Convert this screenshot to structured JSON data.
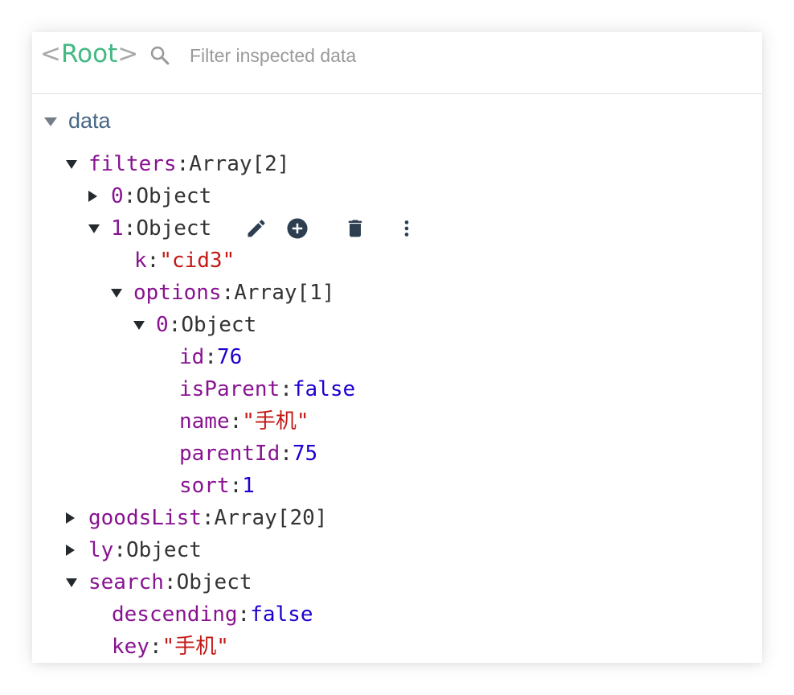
{
  "header": {
    "root_open": "<",
    "root_label": "Root",
    "root_close": ">",
    "filter_placeholder": "Filter inspected data"
  },
  "section": {
    "title": "data"
  },
  "tree": {
    "filters": {
      "key": "filters",
      "type": "Array[2]"
    },
    "filters_0": {
      "key": "0",
      "type": "Object"
    },
    "filters_1": {
      "key": "1",
      "type": "Object"
    },
    "k": {
      "key": "k",
      "value": "\"cid3\""
    },
    "options": {
      "key": "options",
      "type": "Array[1]"
    },
    "options_0": {
      "key": "0",
      "type": "Object"
    },
    "id": {
      "key": "id",
      "value": "76"
    },
    "isParent": {
      "key": "isParent",
      "value": "false"
    },
    "name": {
      "key": "name",
      "value": "\"手机\""
    },
    "parentId": {
      "key": "parentId",
      "value": "75"
    },
    "sort": {
      "key": "sort",
      "value": "1"
    },
    "goodsList": {
      "key": "goodsList",
      "type": "Array[20]"
    },
    "ly": {
      "key": "ly",
      "type": "Object"
    },
    "search": {
      "key": "search",
      "type": "Object"
    },
    "descending": {
      "key": "descending",
      "value": "false"
    },
    "searchKey": {
      "key": "key",
      "value": "\"手机\""
    }
  },
  "icons": {
    "search": "search-icon",
    "edit": "pencil-icon",
    "add": "add-circle-icon",
    "delete": "trash-icon",
    "more": "more-vertical-icon"
  },
  "colors": {
    "root": "#42b983",
    "key": "#881391",
    "string": "#c41a16",
    "literal": "#1c00cf",
    "section": "#486887"
  }
}
